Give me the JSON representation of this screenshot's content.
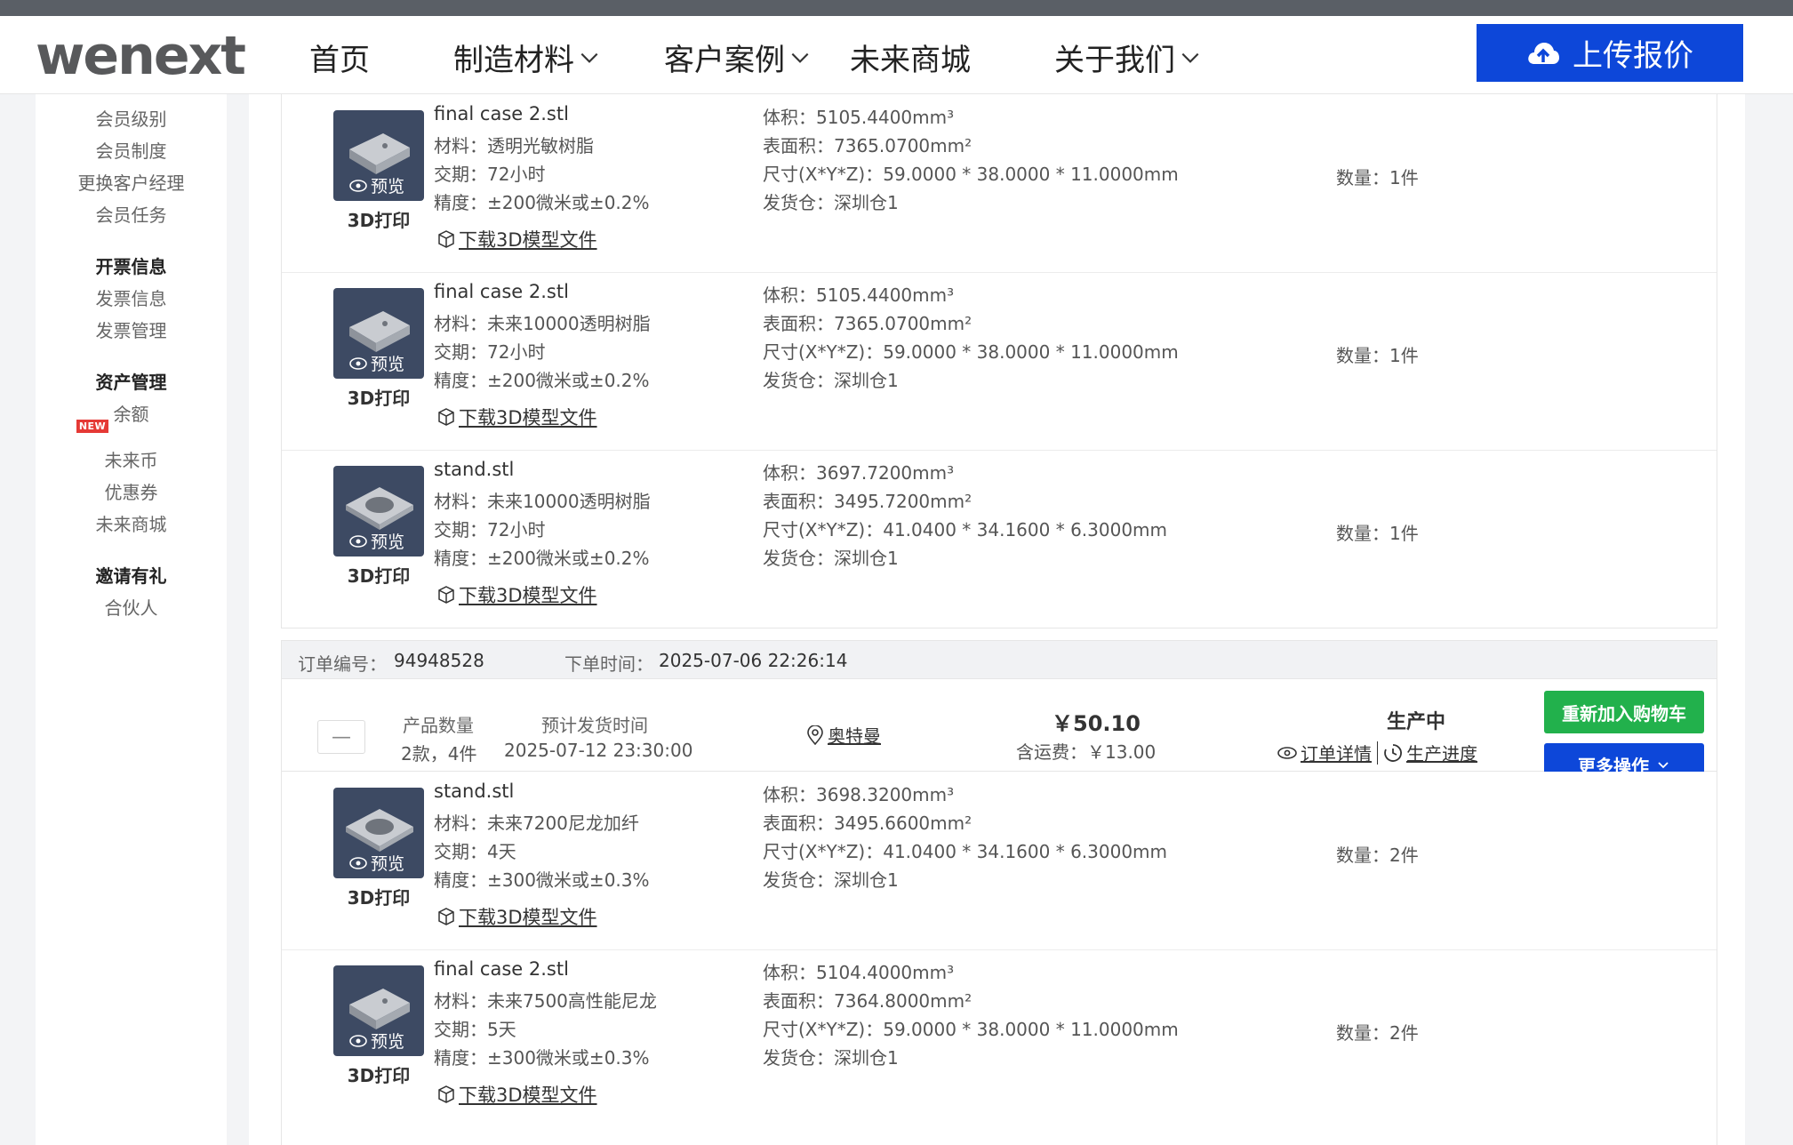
{
  "nav": {
    "logo": "wenext",
    "items": [
      "首页",
      "制造材料",
      "客户案例",
      "未来商城",
      "关于我们"
    ],
    "upload": "上传报价"
  },
  "sidebar": {
    "member_items": [
      "会员级别",
      "会员制度",
      "更换客户经理",
      "会员任务"
    ],
    "invoice_head": "开票信息",
    "invoice_items": [
      "发票信息",
      "发票管理"
    ],
    "asset_head": "资产管理",
    "asset_items": [
      "余额",
      "未来币",
      "优惠券",
      "未来商城"
    ],
    "new_badge": "NEW",
    "invite_head": "邀请有礼",
    "invite_items": [
      "合伙人"
    ]
  },
  "common": {
    "preview": "预览",
    "process": "3D打印",
    "download": "下载3D模型文件"
  },
  "order1": {
    "items": [
      {
        "file": "final case 2.stl",
        "material": "材料：透明光敏树脂",
        "lead": "交期：72小时",
        "precision": "精度：±200微米或±0.2%",
        "volume": "体积：5105.4400mm³",
        "area": "表面积：7365.0700mm²",
        "size": "尺寸(X*Y*Z)：59.0000 * 38.0000 * 11.0000mm",
        "warehouse": "发货仓：深圳仓1",
        "qty": "数量：1件"
      },
      {
        "file": "final case 2.stl",
        "material": "材料：未来10000透明树脂",
        "lead": "交期：72小时",
        "precision": "精度：±200微米或±0.2%",
        "volume": "体积：5105.4400mm³",
        "area": "表面积：7365.0700mm²",
        "size": "尺寸(X*Y*Z)：59.0000 * 38.0000 * 11.0000mm",
        "warehouse": "发货仓：深圳仓1",
        "qty": "数量：1件"
      },
      {
        "file": "stand.stl",
        "material": "材料：未来10000透明树脂",
        "lead": "交期：72小时",
        "precision": "精度：±200微米或±0.2%",
        "volume": "体积：3697.7200mm³",
        "area": "表面积：3495.7200mm²",
        "size": "尺寸(X*Y*Z)：41.0400 * 34.1600 * 6.3000mm",
        "warehouse": "发货仓：深圳仓1",
        "qty": "数量：1件"
      }
    ]
  },
  "order2": {
    "no_label": "订单编号：",
    "no": "94948528",
    "time_label": "下单时间：",
    "time": "2025-07-06 22:26:14",
    "collapse": "—",
    "count_label": "产品数量",
    "count": "2款，4件",
    "ship_label": "预计发货时间",
    "ship": "2025-07-12 23:30:00",
    "address": "奥特曼",
    "price": "￥50.10",
    "freight": "含运费：￥13.00",
    "status": "生产中",
    "detail": "订单详情",
    "progress": "生产进度",
    "readd": "重新加入购物车",
    "more": "更多操作",
    "items": [
      {
        "file": "stand.stl",
        "material": "材料：未来7200尼龙加纤",
        "lead": "交期：4天",
        "precision": "精度：±300微米或±0.3%",
        "volume": "体积：3698.3200mm³",
        "area": "表面积：3495.6600mm²",
        "size": "尺寸(X*Y*Z)：41.0400 * 34.1600 * 6.3000mm",
        "warehouse": "发货仓：深圳仓1",
        "qty": "数量：2件"
      },
      {
        "file": "final case 2.stl",
        "material": "材料：未来7500高性能尼龙",
        "lead": "交期：5天",
        "precision": "精度：±300微米或±0.3%",
        "volume": "体积：5104.4000mm³",
        "area": "表面积：7364.8000mm²",
        "size": "尺寸(X*Y*Z)：59.0000 * 38.0000 * 11.0000mm",
        "warehouse": "发货仓：深圳仓1",
        "qty": "数量：2件"
      }
    ]
  },
  "colors": {
    "brand_blue": "#0d47d9",
    "green": "#22b14c",
    "thumb_bg": "#3d4a63"
  }
}
